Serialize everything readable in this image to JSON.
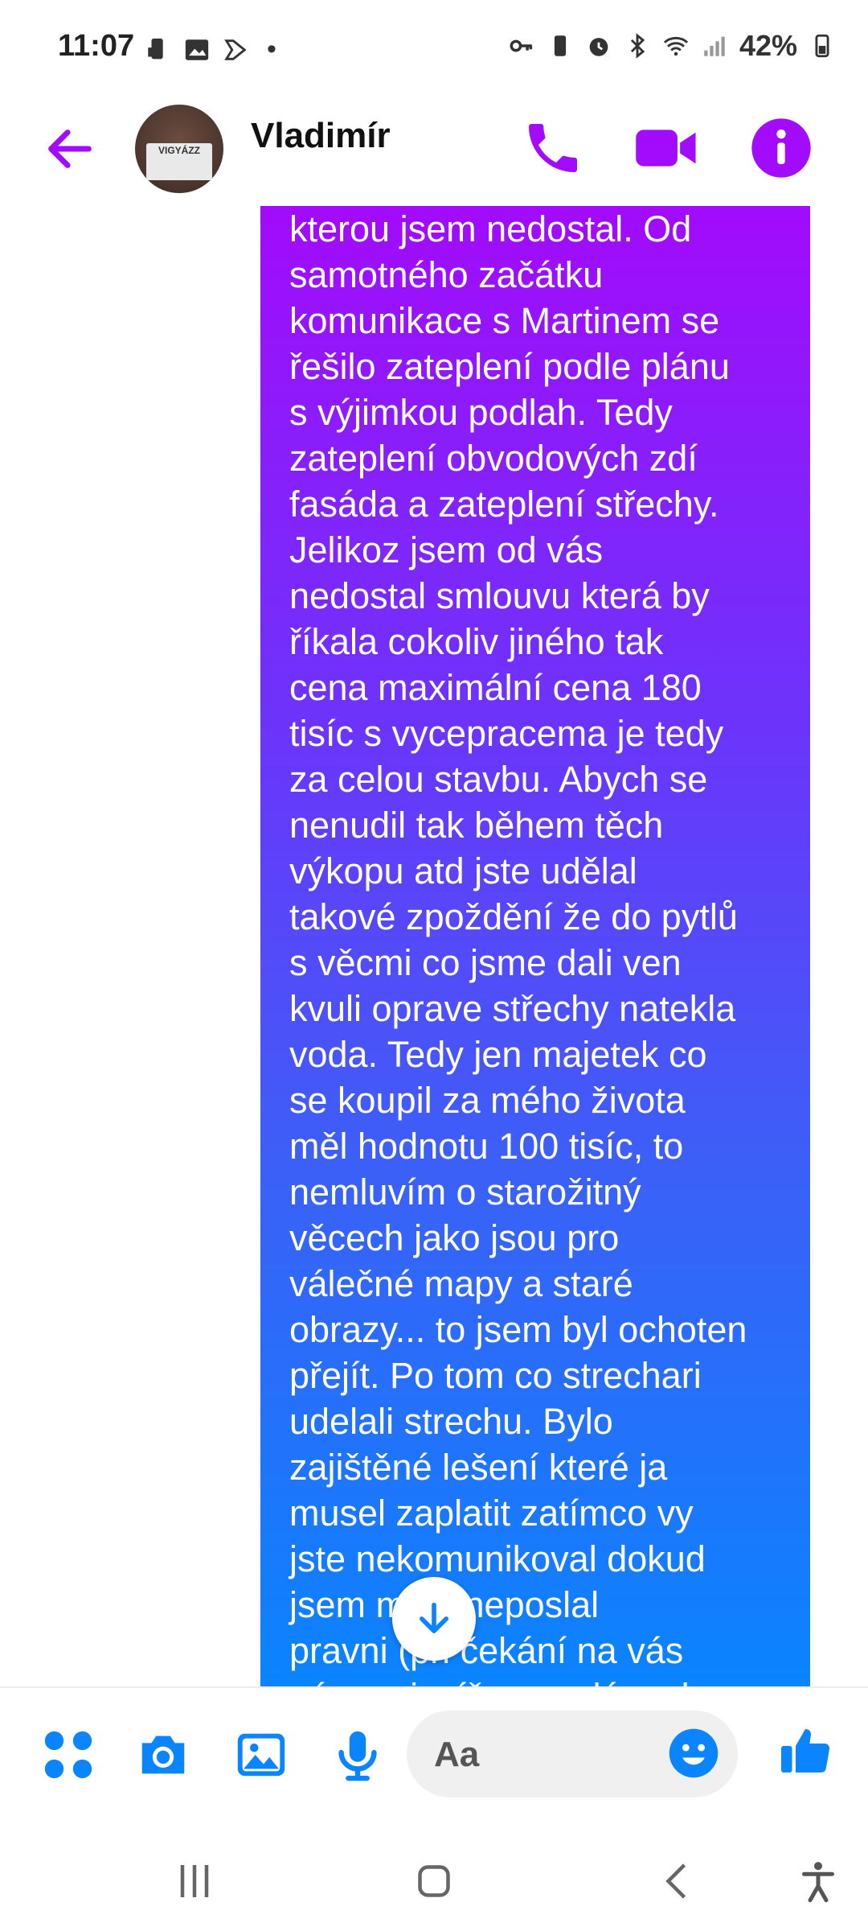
{
  "status_bar": {
    "time": "11:07",
    "battery": "42%",
    "dot": "•"
  },
  "header": {
    "contact_name": "Vladimír",
    "avatar_sign_text": "VIGYÁZZ"
  },
  "message": {
    "text": "kterou jsem nedostal. Od\nsamotného začátku\nkomunikace s Martinem se\nřešilo zateplení podle plánu\ns výjimkou podlah. Tedy\nzateplení obvodových zdí\nfasáda a zateplení střechy.\nJelikoz jsem od vás\nnedostal smlouvu která by\nříkala cokoliv jiného tak\ncena maximální cena 180\ntisíc s vycepracema je tedy\nza celou stavbu. Abych se\nnenudil tak během těch\nvýkopu atd jste udělal\ntakové zpoždění  že do pytlů\ns věcmi co jsme dali ven\nkvuli oprave střechy natekla\nvoda. Tedy jen majetek co\nse koupil za mého života\nměl hodnotu 100 tisíc, to\nnemluvím o starožitný\nvěcech jako jsou pro\nválečné mapy a staré\nobrazy... to jsem byl ochoten\npřejít.  Po tom co strechari\nudelali strechu. Bylo\nzajištěné lešení které ja\nmusel zaplatit zatímco vy\njste nekomunikoval dokud\njsem m     ěš neposlal\npravni     (při čekání na vás\nnám nejspíše zmrzlá voda v"
  },
  "composer": {
    "placeholder": "Aa"
  },
  "colors": {
    "accent": "#a20bfb",
    "messenger_blue": "#0a84ff",
    "bubble_top": "#a20bfb",
    "bubble_bottom": "#0a84ff"
  },
  "icons": {
    "back": "arrow-left-icon",
    "call": "phone-icon",
    "video": "video-camera-icon",
    "info": "info-icon",
    "apps": "four-dots-icon",
    "camera": "camera-icon",
    "gallery": "image-icon",
    "mic": "microphone-icon",
    "emoji": "emoji-icon",
    "like": "thumbs-up-icon",
    "scroll": "arrow-down-icon"
  }
}
